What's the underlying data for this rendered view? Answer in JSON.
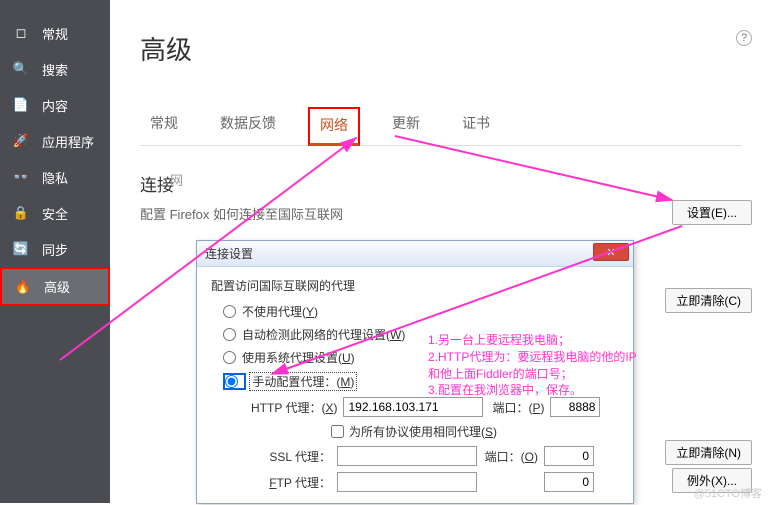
{
  "sidebar": {
    "items": [
      {
        "label": "常规",
        "icon": "◻"
      },
      {
        "label": "搜索",
        "icon": "🔍"
      },
      {
        "label": "内容",
        "icon": "📄"
      },
      {
        "label": "应用程序",
        "icon": "🚀"
      },
      {
        "label": "隐私",
        "icon": "👓"
      },
      {
        "label": "安全",
        "icon": "🔒"
      },
      {
        "label": "同步",
        "icon": "🔄"
      },
      {
        "label": "高级",
        "icon": "🔥"
      }
    ]
  },
  "page": {
    "title": "高级",
    "help_icon": "?"
  },
  "tabs": {
    "general": "常规",
    "datafb": "数据反馈",
    "network": "网络",
    "update": "更新",
    "certs": "证书"
  },
  "conn": {
    "title": "连接",
    "desc": "配置 Firefox 如何连接至国际互联网",
    "settings_btn": "设置(E)...",
    "cache_clear": "立即清除(C)",
    "store_clear": "立即清除(N)",
    "exceptions": "例外(X)...",
    "hidden": "网"
  },
  "dialog": {
    "title": "连接设置",
    "group": "配置访问国际互联网的代理",
    "r1": "不使用代理(Y)",
    "r2": "自动检测此网络的代理设置(W)",
    "r3": "使用系统代理设置(U)",
    "r4": "手动配置代理：(M)",
    "http_lbl": "HTTP 代理：(X)",
    "http_val": "192.168.103.171",
    "port_lbl": "端口：(P)",
    "port_val": "8888",
    "same_proxy": "为所有协议使用相同代理(S)",
    "ssl_lbl": "SSL 代理：",
    "ssl_val": "",
    "ssl_port_lbl": "端口：(O)",
    "ftp_lbl": "FTP 代理：",
    "ftp_val": "",
    "zero": "0",
    "close_x": "✕"
  },
  "annotation": {
    "l1": "1.另一台上要远程我电脑；",
    "l2": "2.HTTP代理为：要远程我电脑的他的IP",
    "l3": "和他上面Fiddler的端口号；",
    "l4": "3.配置在我浏览器中，保存。"
  },
  "watermark": "@51CTO博客"
}
